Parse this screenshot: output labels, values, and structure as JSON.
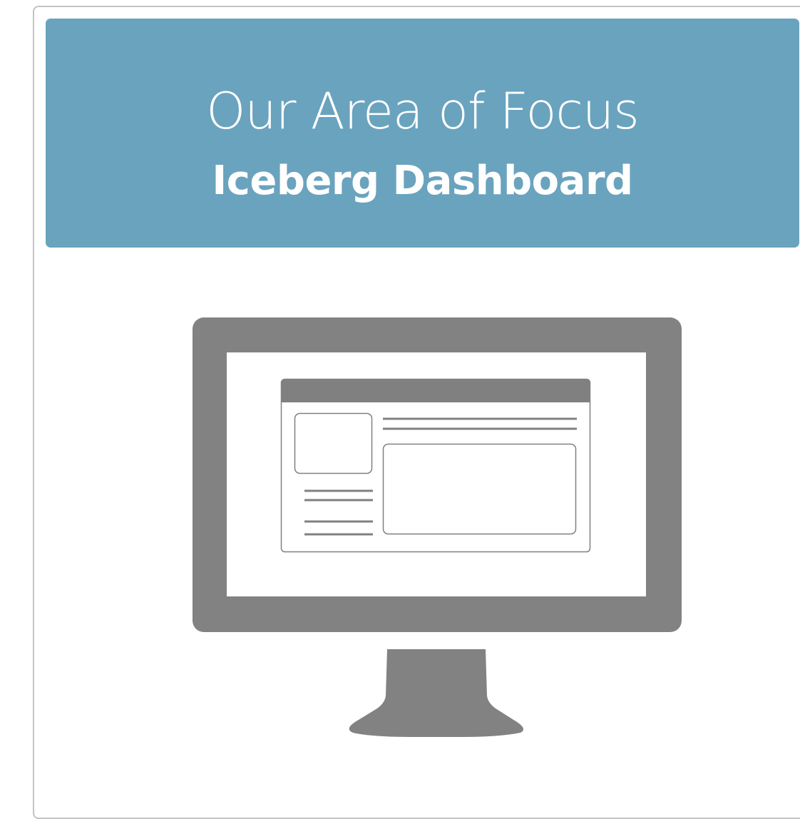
{
  "banner": {
    "title": "Our Area of Focus",
    "subtitle": "Iceberg Dashboard"
  },
  "illustration": {
    "icon": "monitor-dashboard-icon",
    "colors": {
      "banner_bg": "#6aa3be",
      "monitor": "#828282",
      "screen": "#ffffff",
      "wireframe_line": "#808080"
    }
  }
}
